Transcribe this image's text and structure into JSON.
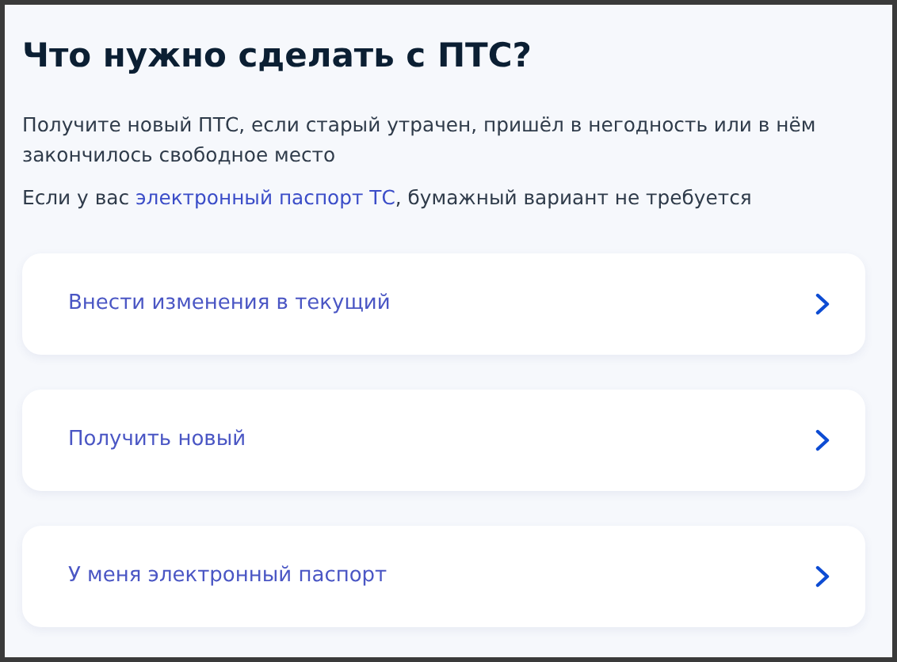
{
  "title": "Что нужно сделать с ПТС?",
  "description": "Получите новый ПТС, если старый утрачен, пришёл в негодность или в нём закончилось свободное место",
  "note": {
    "before": "Если у вас ",
    "link": "электронный паспорт ТС",
    "after": ", бумажный вариант не требуется"
  },
  "options": [
    {
      "label": "Внести изменения в текущий"
    },
    {
      "label": "Получить новый"
    },
    {
      "label": "У меня электронный паспорт"
    }
  ]
}
